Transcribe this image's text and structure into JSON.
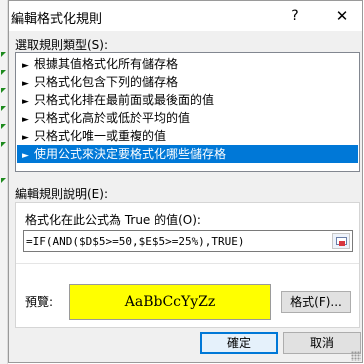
{
  "window": {
    "title": "編輯格式化規則",
    "help_label": "?",
    "close_label": "✕"
  },
  "rule_type": {
    "label": "選取規則類型(S):",
    "items": [
      {
        "label": "根據其值格式化所有儲存格"
      },
      {
        "label": "只格式化包含下列的儲存格"
      },
      {
        "label": "只格式化排在最前面或最後面的值"
      },
      {
        "label": "只格式化高於或低於平均的值"
      },
      {
        "label": "只格式化唯一或重複的值"
      },
      {
        "label": "使用公式來決定要格式化哪些儲存格"
      }
    ],
    "selected_index": 5,
    "arrow_glyph": "►"
  },
  "rule_description": {
    "label": "編輯規則說明(E):",
    "formula_label": "格式化在此公式為 True 的值(O):",
    "formula_value": "=IF(AND($D$5>=50,$E$5>=25%),TRUE)",
    "preview_label": "預覽:",
    "preview_text": "AaBbCcYyZz",
    "preview_fill": "#ffff00",
    "format_button_label": "格式(F)..."
  },
  "buttons": {
    "ok_label": "確定",
    "cancel_label": "取消"
  },
  "colors": {
    "selection": "#0078d7",
    "dialog_bg": "#f0f0f0"
  },
  "icons": {
    "list_arrow": "triangle-right-icon",
    "collapse": "collapse-dialog-icon",
    "help": "question-mark-icon",
    "close": "close-icon"
  }
}
